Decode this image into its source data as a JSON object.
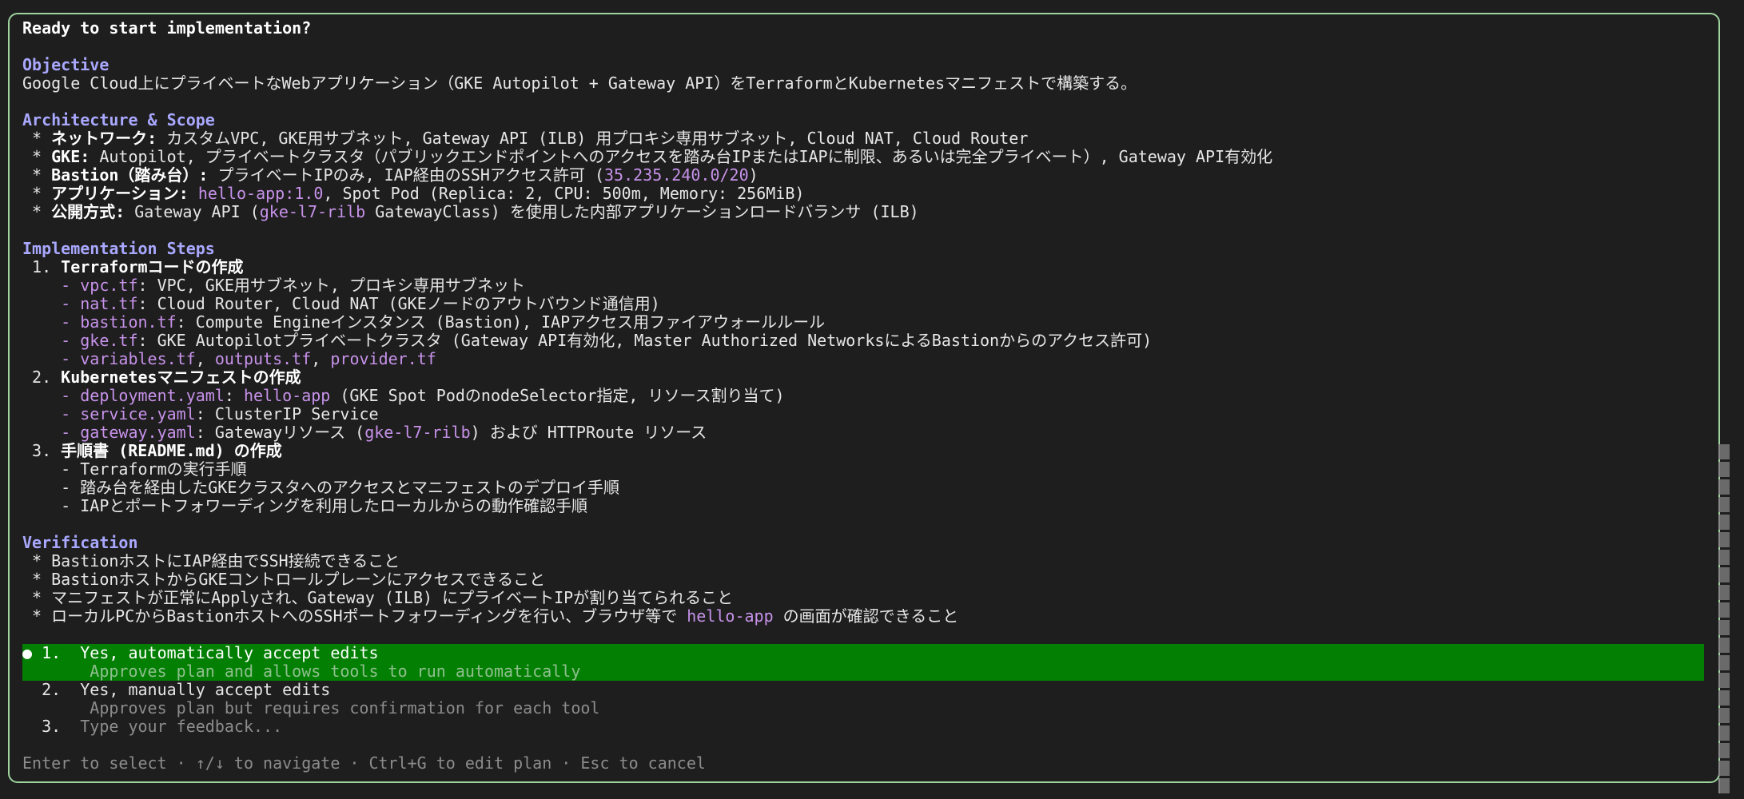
{
  "title": "Ready to start implementation?",
  "objective": {
    "heading": "Objective",
    "text": "Google Cloud上にプライベートなWebアプリケーション（GKE Autopilot + Gateway API）をTerraformとKubernetesマニフェストで構築する。"
  },
  "architecture": {
    "heading": "Architecture & Scope",
    "items": [
      {
        "bullet": " * ",
        "label": "ネットワーク:",
        "text": " カスタムVPC, GKE用サブネット, Gateway API (ILB) 用プロキシ専用サブネット, Cloud NAT, Cloud Router"
      },
      {
        "bullet": " * ",
        "label": "GKE:",
        "text": " Autopilot, プライベートクラスタ（パブリックエンドポイントへのアクセスを踏み台IPまたはIAPに制限、あるいは完全プライベート）, Gateway API有効化"
      },
      {
        "bullet": " * ",
        "label": "Bastion（踏み台）:",
        "text": " プライベートIPのみ, IAP経由のSSHアクセス許可 (",
        "code": "35.235.240.0/20",
        "tail": ")"
      },
      {
        "bullet": " * ",
        "label": "アプリケーション:",
        "text": " ",
        "code": "hello-app:1.0",
        "tail": ", Spot Pod (Replica: 2, CPU: 500m, Memory: 256MiB)"
      },
      {
        "bullet": " * ",
        "label": "公開方式:",
        "text": " Gateway API (",
        "code": "gke-l7-rilb",
        "tail": " GatewayClass) を使用した内部アプリケーションロードバランサ (ILB)"
      }
    ]
  },
  "steps": {
    "heading": "Implementation Steps",
    "step1": {
      "num": " 1. ",
      "label": "Terraformコードの作成"
    },
    "step1_items": [
      {
        "dash": "    - ",
        "code": "vpc.tf",
        "text": ": VPC, GKE用サブネット, プロキシ専用サブネット"
      },
      {
        "dash": "    - ",
        "code": "nat.tf",
        "text": ": Cloud Router, Cloud NAT (GKEノードのアウトバウンド通信用)"
      },
      {
        "dash": "    - ",
        "code": "bastion.tf",
        "text": ": Compute Engineインスタンス (Bastion), IAPアクセス用ファイアウォールルール"
      },
      {
        "dash": "    - ",
        "code": "gke.tf",
        "text": ": GKE Autopilotプライベートクラスタ (Gateway API有効化, Master Authorized NetworksによるBastionからのアクセス許可)"
      }
    ],
    "step1_files": {
      "dash": "    - ",
      "f1": "variables.tf",
      "sep1": ", ",
      "f2": "outputs.tf",
      "sep2": ", ",
      "f3": "provider.tf"
    },
    "step2": {
      "num": " 2. ",
      "label": "Kubernetesマニフェストの作成"
    },
    "step2_items": [
      {
        "dash": "    - ",
        "code": "deployment.yaml",
        "text": ": ",
        "code2": "hello-app",
        "tail": " (GKE Spot PodのnodeSelector指定, リソース割り当て)"
      },
      {
        "dash": "    - ",
        "code": "service.yaml",
        "text": ": ClusterIP Service",
        "code2": "",
        "tail": ""
      },
      {
        "dash": "    - ",
        "code": "gateway.yaml",
        "text": ": Gatewayリソース (",
        "code2": "gke-l7-rilb",
        "tail": ") および HTTPRoute リソース"
      }
    ],
    "step3": {
      "num": " 3. ",
      "label": "手順書 (README.md) の作成"
    },
    "step3_items": [
      "    - Terraformの実行手順",
      "    - 踏み台を経由したGKEクラスタへのアクセスとマニフェストのデプロイ手順",
      "    - IAPとポートフォワーディングを利用したローカルからの動作確認手順"
    ]
  },
  "verification": {
    "heading": "Verification",
    "items": [
      " * BastionホストにIAP経由でSSH接続できること",
      " * BastionホストからGKEコントロールプレーンにアクセスできること",
      " * マニフェストが正常にApplyされ、Gateway (ILB) にプライベートIPが割り当てられること"
    ],
    "last": {
      "text": " * ローカルPCからBastionホストへのSSHポートフォワーディングを行い、ブラウザ等で ",
      "code": "hello-app",
      "tail": " の画面が確認できること"
    }
  },
  "options": [
    {
      "marker": "● 1.  ",
      "label": "Yes, automatically accept edits",
      "desc": "       Approves plan and allows tools to run automatically",
      "selected": true
    },
    {
      "marker": "  2.  ",
      "label": "Yes, manually accept edits",
      "desc": "       Approves plan but requires confirmation for each tool",
      "selected": false
    },
    {
      "marker": "  3.  ",
      "label": "Type your feedback...",
      "desc": "",
      "selected": false
    }
  ],
  "footer": "Enter to select · ↑/↓ to navigate · Ctrl+G to edit plan · Esc to cancel",
  "colors": {
    "accent": "#a9a8ff",
    "code": "#c792ea",
    "selected_bg": "#038003",
    "border": "#9ed39e"
  }
}
